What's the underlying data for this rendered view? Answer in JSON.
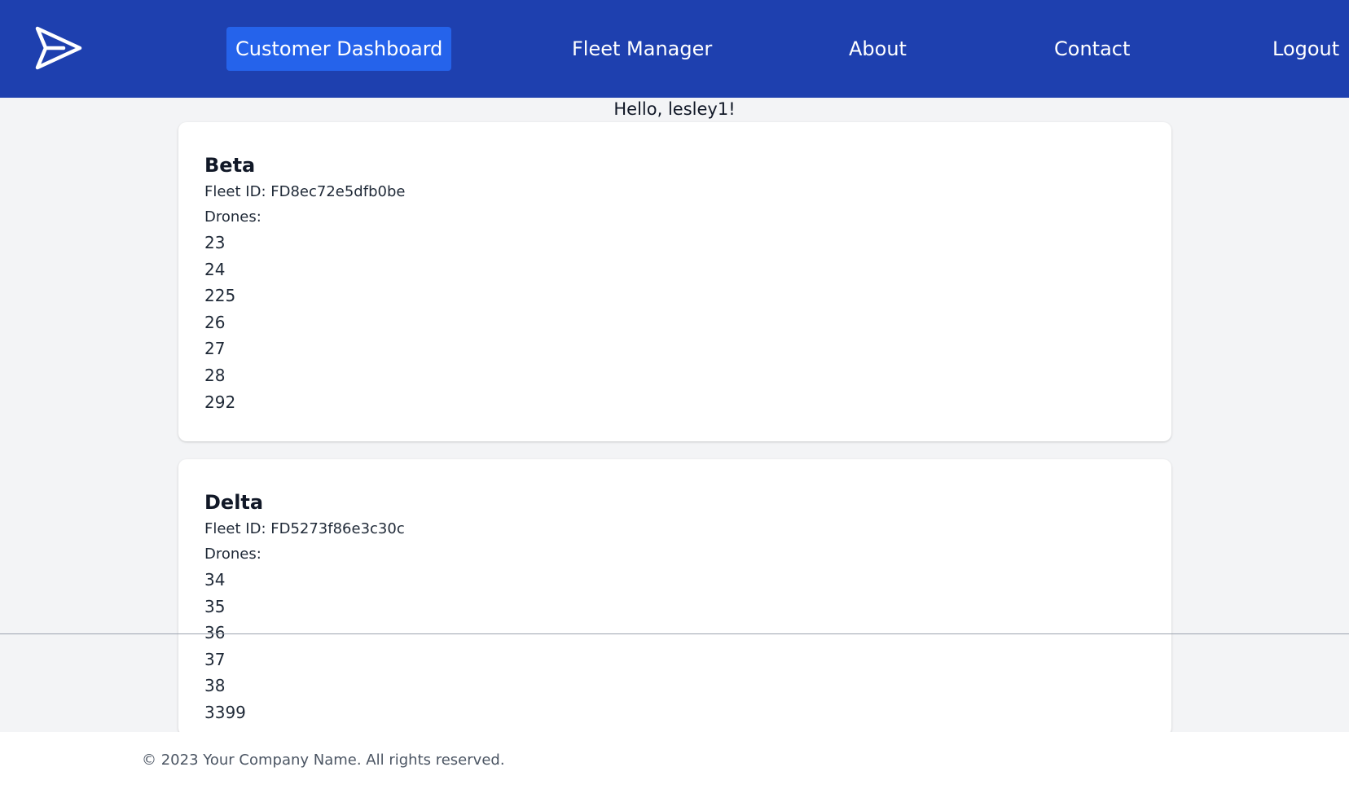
{
  "nav": {
    "logo_icon": "paper-plane-icon",
    "items": [
      {
        "label": "Customer Dashboard",
        "active": true
      },
      {
        "label": "Fleet Manager",
        "active": false
      },
      {
        "label": "About",
        "active": false
      },
      {
        "label": "Contact",
        "active": false
      },
      {
        "label": "Logout",
        "active": false
      }
    ]
  },
  "greeting": "Hello, lesley1!",
  "fleets": [
    {
      "name": "Beta",
      "fleet_id_text": "Fleet ID: FD8ec72e5dfb0be",
      "drones_label": "Drones:",
      "drones": [
        "23",
        "24",
        "225",
        "26",
        "27",
        "28",
        "292"
      ]
    },
    {
      "name": "Delta",
      "fleet_id_text": "Fleet ID: FD5273f86e3c30c",
      "drones_label": "Drones:",
      "drones": [
        "34",
        "35",
        "36",
        "37",
        "38",
        "3399"
      ]
    }
  ],
  "footer": {
    "text": "© 2023 Your Company Name. All rights reserved."
  },
  "colors": {
    "nav_bg": "#1e40af",
    "nav_active_bg": "#2563eb",
    "page_bg": "#f3f4f6",
    "card_bg": "#ffffff"
  }
}
